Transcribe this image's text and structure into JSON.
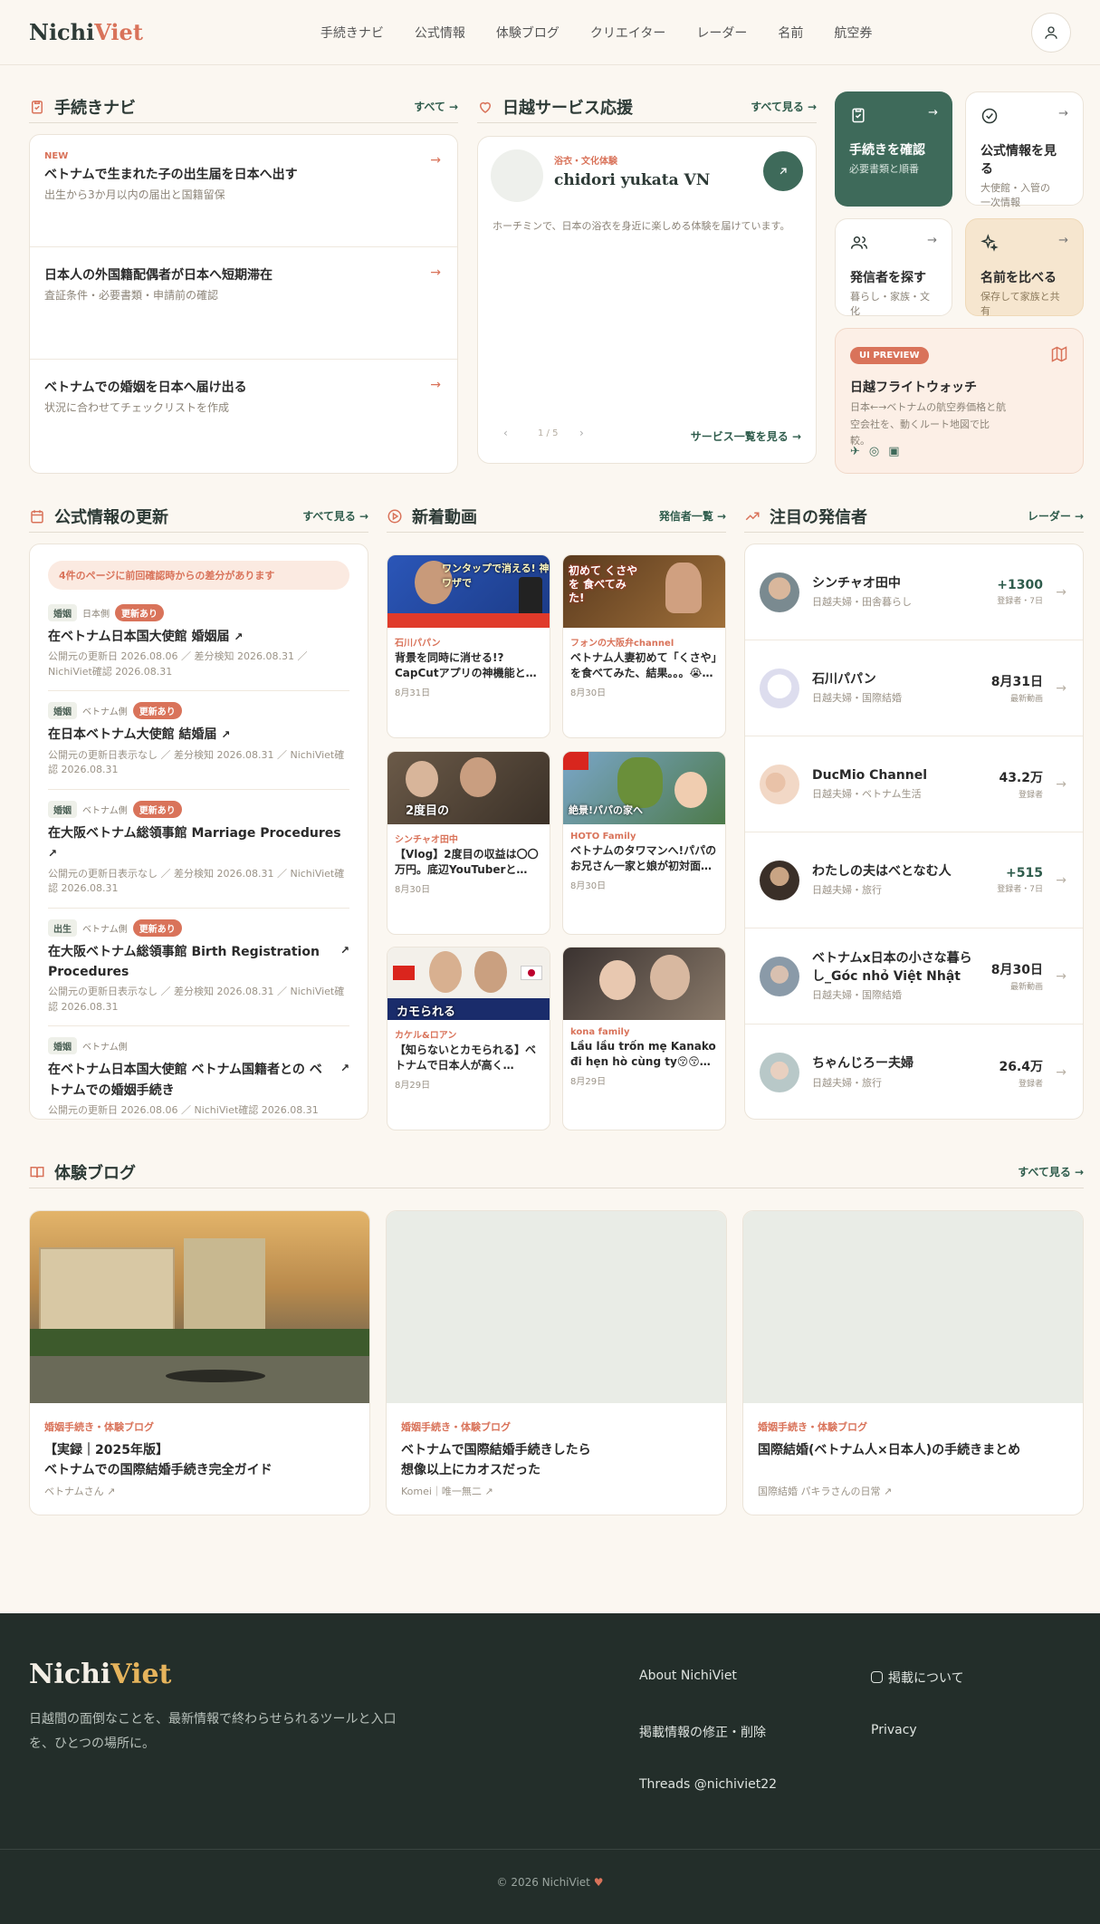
{
  "header": {
    "logo_a": "Nichi",
    "logo_b": "Viet",
    "nav": [
      "手続きナビ",
      "公式情報",
      "体験ブログ",
      "クリエイター",
      "レーダー",
      "名前",
      "航空券"
    ]
  },
  "procedures": {
    "title": "手続きナビ",
    "more": "すべて",
    "items": [
      {
        "badge": "NEW",
        "title": "ベトナムで生まれた子の出生届を日本へ出す",
        "sub": "出生から3か月以内の届出と国籍留保"
      },
      {
        "badge": "",
        "title": "日本人の外国籍配偶者が日本へ短期滞在",
        "sub": "査証条件・必要書類・申請前の確認"
      },
      {
        "badge": "",
        "title": "ベトナムでの婚姻を日本へ届け出る",
        "sub": "状況に合わせてチェックリストを作成"
      }
    ]
  },
  "services": {
    "title": "日越サービス応援",
    "more": "すべて見る",
    "category": "浴衣・文化体験",
    "name": "chidori yukata VN",
    "desc": "ホーチミンで、日本の浴衣を身近に楽しめる体験を届けています。",
    "pager": "1 / 5",
    "list_link": "サービス一覧を見る"
  },
  "tiles": [
    {
      "title": "手続きを確認",
      "sub": "必要書類と順番",
      "icon": "clipboard-icon"
    },
    {
      "title": "公式情報を見る",
      "sub": "大使館・入管の\n一次情報",
      "icon": "check-circle-icon"
    },
    {
      "title": "発信者を探す",
      "sub": "暮らし・家族・文化",
      "icon": "users-icon"
    },
    {
      "title": "名前を比べる",
      "sub": "保存して家族と共有",
      "icon": "sparkle-icon"
    }
  ],
  "flight": {
    "badge": "UI PREVIEW",
    "title": "日越フライトウォッチ",
    "desc": "日本←→ベトナムの航空券価格と航空会社を、動くルート地図で比較。"
  },
  "updates": {
    "title": "公式情報の更新",
    "more": "すべて見る",
    "notice": "4件のページに前回確認時からの差分があります",
    "items": [
      {
        "cat": "婚姻",
        "side": "日本側",
        "badge": "更新あり",
        "title": "在ベトナム日本国大使館 婚姻届",
        "meta": "公開元の更新日 2026.08.06 ／ 差分検知 2026.08.31 ／ NichiViet確認 2026.08.31"
      },
      {
        "cat": "婚姻",
        "side": "ベトナム側",
        "badge": "更新あり",
        "title": "在日本ベトナム大使館 結婚届",
        "meta": "公開元の更新日表示なし ／ 差分検知 2026.08.31 ／ NichiViet確認 2026.08.31"
      },
      {
        "cat": "婚姻",
        "side": "ベトナム側",
        "badge": "更新あり",
        "title": "在大阪ベトナム総領事館 Marriage Procedures",
        "meta": "公開元の更新日表示なし ／ 差分検知 2026.08.31 ／ NichiViet確認 2026.08.31"
      },
      {
        "cat": "出生",
        "side": "ベトナム側",
        "badge": "更新あり",
        "title": "在大阪ベトナム総領事館 Birth Registration Procedures",
        "meta": "公開元の更新日表示なし ／ 差分検知 2026.08.31 ／ NichiViet確認 2026.08.31"
      },
      {
        "cat": "婚姻",
        "side": "ベトナム側",
        "badge": "",
        "title": "在ベトナム日本国大使館 ベトナム国籍者との ベトナムでの婚姻手続き",
        "meta": "公開元の更新日 2026.08.06 ／ NichiViet確認 2026.08.31"
      }
    ]
  },
  "videos": {
    "title": "新着動画",
    "more": "発信者一覧",
    "items": [
      {
        "channel": "石川パパン",
        "title": "背景を同時に消せる!?CapCutアプリの神機能と…",
        "date": "8月31日",
        "caption": "ワンタップで消える! 神ワザで"
      },
      {
        "channel": "フォンの大阪弁channel",
        "title": "ベトナム人妻初めて「くさや」を食べてみた、結果。。。😭…",
        "date": "8月30日",
        "caption": "初めて くさやを 食べてみた!"
      },
      {
        "channel": "シンチャオ田中",
        "title": "【Vlog】2度目の収益は〇〇万円。底辺YouTuberと…",
        "date": "8月30日",
        "caption": "2度目の"
      },
      {
        "channel": "HOTO Family",
        "title": "ベトナムのタワマンへ!パパのお兄さん一家と娘が初対面…",
        "date": "8月30日",
        "caption": "絶景!パパの家へ"
      },
      {
        "channel": "カケル&ロアン",
        "title": "【知らないとカモられる】ベトナムで日本人が高く…",
        "date": "8月29日",
        "caption": "カモられる"
      },
      {
        "channel": "kona family",
        "title": "Lầu lầu trốn mẹ Kanako đi hẹn hò cùng ty😚😚…",
        "date": "8月29日",
        "caption": ""
      }
    ]
  },
  "creators": {
    "title": "注目の発信者",
    "more": "レーダー",
    "items": [
      {
        "name": "シンチャオ田中",
        "sub": "日越夫婦・田舎暮らし",
        "value": "+1300",
        "label": "登録者・7日"
      },
      {
        "name": "石川パパン",
        "sub": "日越夫婦・国際結婚",
        "value": "8月31日",
        "label": "最新動画"
      },
      {
        "name": "DucMio Channel",
        "sub": "日越夫婦・ベトナム生活",
        "value": "43.2万",
        "label": "登録者"
      },
      {
        "name": "わたしの夫はべとなむ人",
        "sub": "日越夫婦・旅行",
        "value": "+515",
        "label": "登録者・7日"
      },
      {
        "name": "ベトナムx日本の小さな暮らし_Góc nhỏ Việt Nhật",
        "sub": "日越夫婦・国際結婚",
        "value": "8月30日",
        "label": "最新動画"
      },
      {
        "name": "ちゃんじろー夫婦",
        "sub": "日越夫婦・旅行",
        "value": "26.4万",
        "label": "登録者"
      }
    ]
  },
  "blog": {
    "title": "体験ブログ",
    "more": "すべて見る",
    "items": [
      {
        "cat": "婚姻手続き・体験ブログ",
        "title": "【実録｜2025年版】\nベトナムでの国際結婚手続き完全ガイド",
        "author": "ベトナムさん"
      },
      {
        "cat": "婚姻手続き・体験ブログ",
        "title": "ベトナムで国際結婚手続きしたら\n想像以上にカオスだった",
        "author": "Komei｜唯一無二"
      },
      {
        "cat": "婚姻手続き・体験ブログ",
        "title": "国際結婚(ベトナム人×日本人)の手続きまとめ",
        "author": "国際結婚 パキラさんの日常"
      }
    ]
  },
  "footer": {
    "logo_a": "Nichi",
    "logo_b": "Viet",
    "tagline": "日越間の面倒なことを、最新情報で終わらせられるツールと入口を、ひとつの場所に。",
    "links": [
      "About NichiViet",
      "掲載について",
      "掲載情報の修正・削除",
      "Privacy",
      "Threads @nichiviet22"
    ],
    "copyright": "© 2026 NichiViet"
  },
  "colors": {
    "brand_green": "#2f5c4c",
    "accent": "#d9735a",
    "footer_bg": "#232e2a"
  }
}
